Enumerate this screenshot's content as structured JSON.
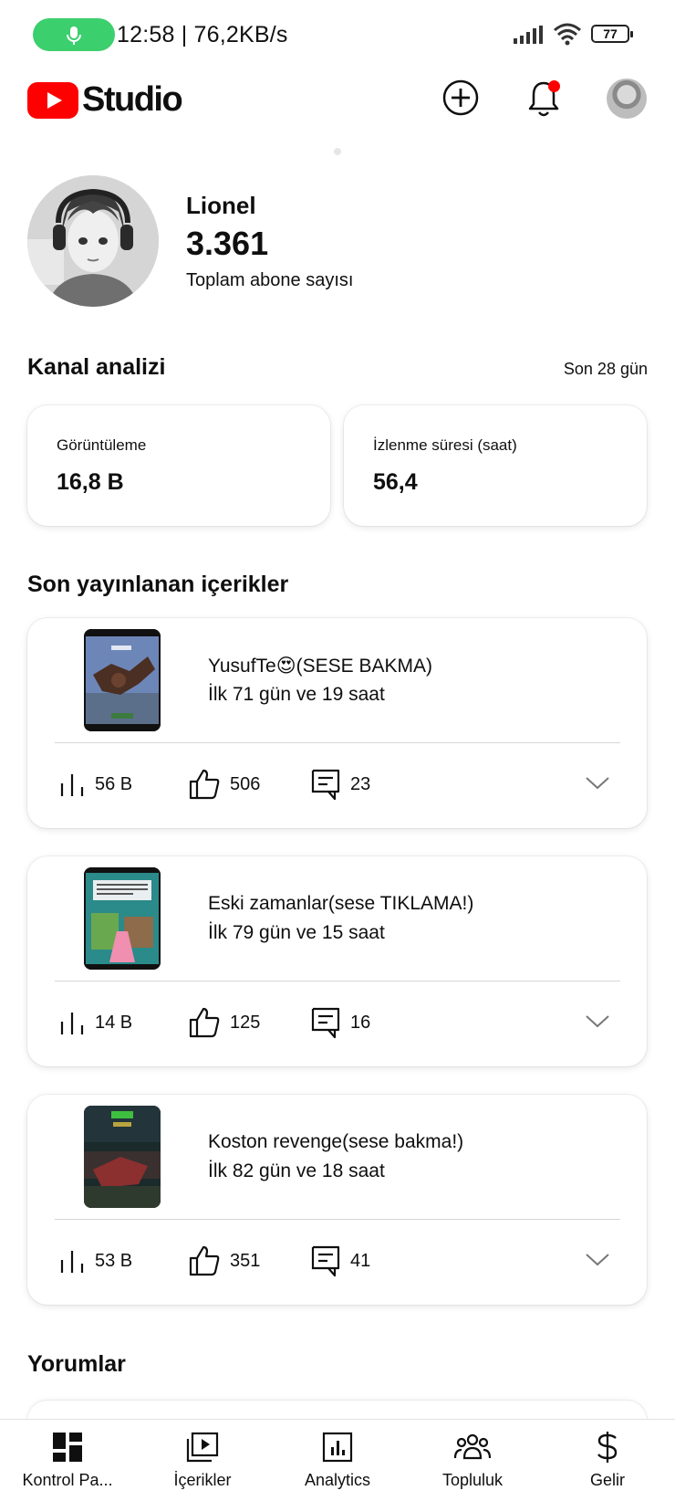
{
  "status_bar": {
    "time_speed": "12:58 | 76,2KB/s",
    "battery": "77"
  },
  "header": {
    "logo_text": "Studio",
    "brand_color": "#ff0000",
    "icons": [
      "create-icon",
      "notifications-bell-icon",
      "account-avatar"
    ]
  },
  "channel": {
    "name": "Lionel",
    "subscriber_count": "3.361",
    "subscriber_label": "Toplam abone sayısı"
  },
  "analytics": {
    "title": "Kanal analizi",
    "period": "Son 28 gün",
    "metrics": [
      {
        "label": "Görüntüleme",
        "value": "16,8 B"
      },
      {
        "label": "İzlenme süresi (saat)",
        "value": "56,4"
      }
    ]
  },
  "recent": {
    "title": "Son yayınlanan içerikler",
    "videos": [
      {
        "title": "YusufTe😍(SESE BAKMA)",
        "age": "İlk 71 gün ve 19 saat",
        "views": "56 B",
        "likes": "506",
        "comments": "23"
      },
      {
        "title": "Eski zamanlar(sese TIKLAMA!)",
        "age": "İlk 79 gün ve 15 saat",
        "views": "14 B",
        "likes": "125",
        "comments": "16"
      },
      {
        "title": "Koston revenge(sese bakma!)",
        "age": "İlk 82 gün ve 18 saat",
        "views": "53 B",
        "likes": "351",
        "comments": "41"
      }
    ]
  },
  "comments_section": {
    "title": "Yorumlar"
  },
  "bottom_nav": {
    "items": [
      {
        "label": "Kontrol Pa...",
        "icon": "dashboard-icon"
      },
      {
        "label": "İçerikler",
        "icon": "content-icon"
      },
      {
        "label": "Analytics",
        "icon": "analytics-icon"
      },
      {
        "label": "Topluluk",
        "icon": "community-icon"
      },
      {
        "label": "Gelir",
        "icon": "earn-icon"
      }
    ]
  }
}
